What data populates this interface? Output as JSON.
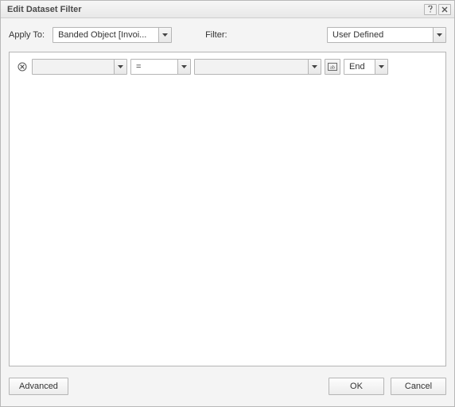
{
  "title": "Edit Dataset Filter",
  "apply_to": {
    "label": "Apply To:",
    "value": "Banded Object [Invoi..."
  },
  "filter": {
    "label": "Filter:",
    "value": "User Defined"
  },
  "row": {
    "field": "",
    "operator": "=",
    "value": "",
    "logic": "End"
  },
  "buttons": {
    "advanced": "Advanced",
    "ok": "OK",
    "cancel": "Cancel"
  }
}
